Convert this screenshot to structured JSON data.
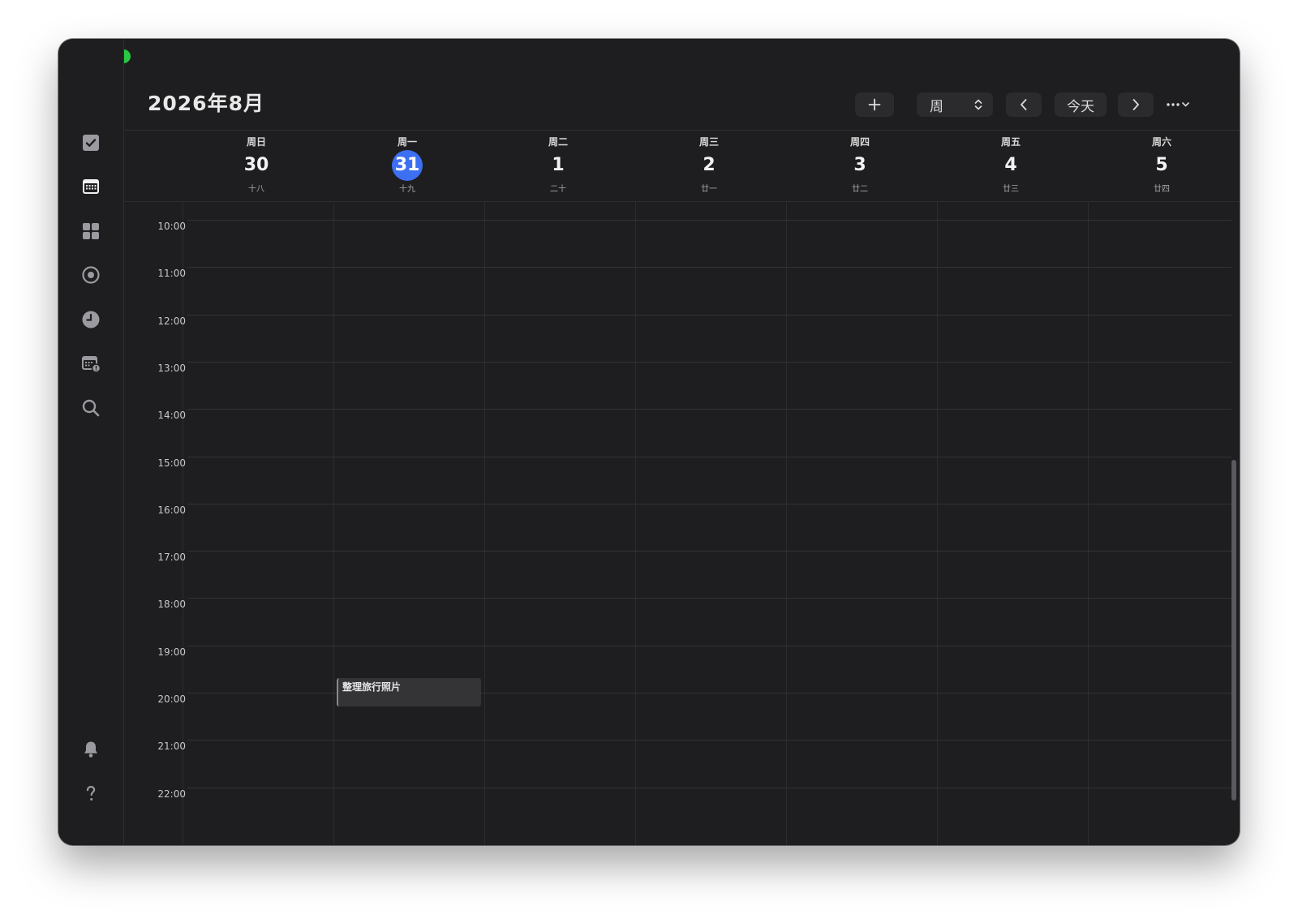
{
  "window": {
    "title": "2026年8月"
  },
  "toolbar": {
    "add_icon": "plus-icon",
    "view_mode": "周",
    "prev_icon": "chevron-left-icon",
    "today_label": "今天",
    "next_icon": "chevron-right-icon",
    "more_icon": "ellipsis-icon"
  },
  "sidebar": {
    "items": [
      {
        "name": "tasks",
        "icon": "checkbox-icon"
      },
      {
        "name": "calendar",
        "icon": "calendar-icon"
      },
      {
        "name": "matrix",
        "icon": "grid-icon"
      },
      {
        "name": "habit",
        "icon": "target-icon"
      },
      {
        "name": "focus",
        "icon": "clock-icon"
      },
      {
        "name": "schedule",
        "icon": "calendar-alert-icon"
      },
      {
        "name": "search",
        "icon": "search-icon"
      }
    ],
    "bottom_items": [
      {
        "name": "notifications",
        "icon": "bell-icon"
      },
      {
        "name": "help",
        "icon": "question-icon"
      }
    ]
  },
  "week": {
    "days": [
      {
        "dow": "周日",
        "num": "30",
        "lunar": "十八",
        "today": false
      },
      {
        "dow": "周一",
        "num": "31",
        "lunar": "十九",
        "today": true
      },
      {
        "dow": "周二",
        "num": "1",
        "lunar": "二十",
        "today": false
      },
      {
        "dow": "周三",
        "num": "2",
        "lunar": "廿一",
        "today": false
      },
      {
        "dow": "周四",
        "num": "3",
        "lunar": "廿二",
        "today": false
      },
      {
        "dow": "周五",
        "num": "4",
        "lunar": "廿三",
        "today": false
      },
      {
        "dow": "周六",
        "num": "5",
        "lunar": "廿四",
        "today": false
      }
    ]
  },
  "hours": [
    "10:00",
    "11:00",
    "12:00",
    "13:00",
    "14:00",
    "15:00",
    "16:00",
    "17:00",
    "18:00",
    "19:00",
    "20:00",
    "21:00",
    "22:00"
  ],
  "events": [
    {
      "title": "整理旅行照片",
      "day_index": 1,
      "start_hour": 19.6,
      "end_hour": 20.2
    }
  ],
  "colors": {
    "accent": "#3d6ff2",
    "background": "#1e1e20"
  }
}
